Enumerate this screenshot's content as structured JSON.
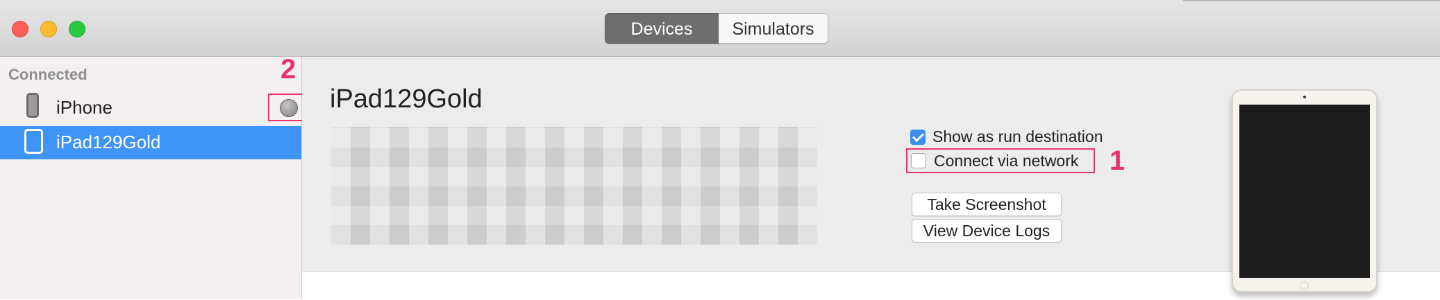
{
  "window": {
    "tabs": [
      {
        "label": "Devices",
        "selected": true
      },
      {
        "label": "Simulators",
        "selected": false
      }
    ]
  },
  "sidebar": {
    "section_label": "Connected",
    "devices": [
      {
        "name": "iPhone",
        "icon": "iphone-icon",
        "selected": false,
        "network_icon": "network-globe-icon"
      },
      {
        "name": "iPad129Gold",
        "icon": "ipad-icon",
        "selected": true
      }
    ]
  },
  "detail": {
    "device_name": "iPad129Gold",
    "options": {
      "show_as_run_destination": {
        "label": "Show as run destination",
        "checked": true
      },
      "connect_via_network": {
        "label": "Connect via network",
        "checked": false
      }
    },
    "buttons": {
      "take_screenshot": "Take Screenshot",
      "view_device_logs": "View Device Logs"
    }
  },
  "annotations": {
    "callout_1": "1",
    "callout_2": "2",
    "color": "#e8326e"
  },
  "colors": {
    "accent": "#3f94f7",
    "selected_tab": "#6d6d6d"
  }
}
